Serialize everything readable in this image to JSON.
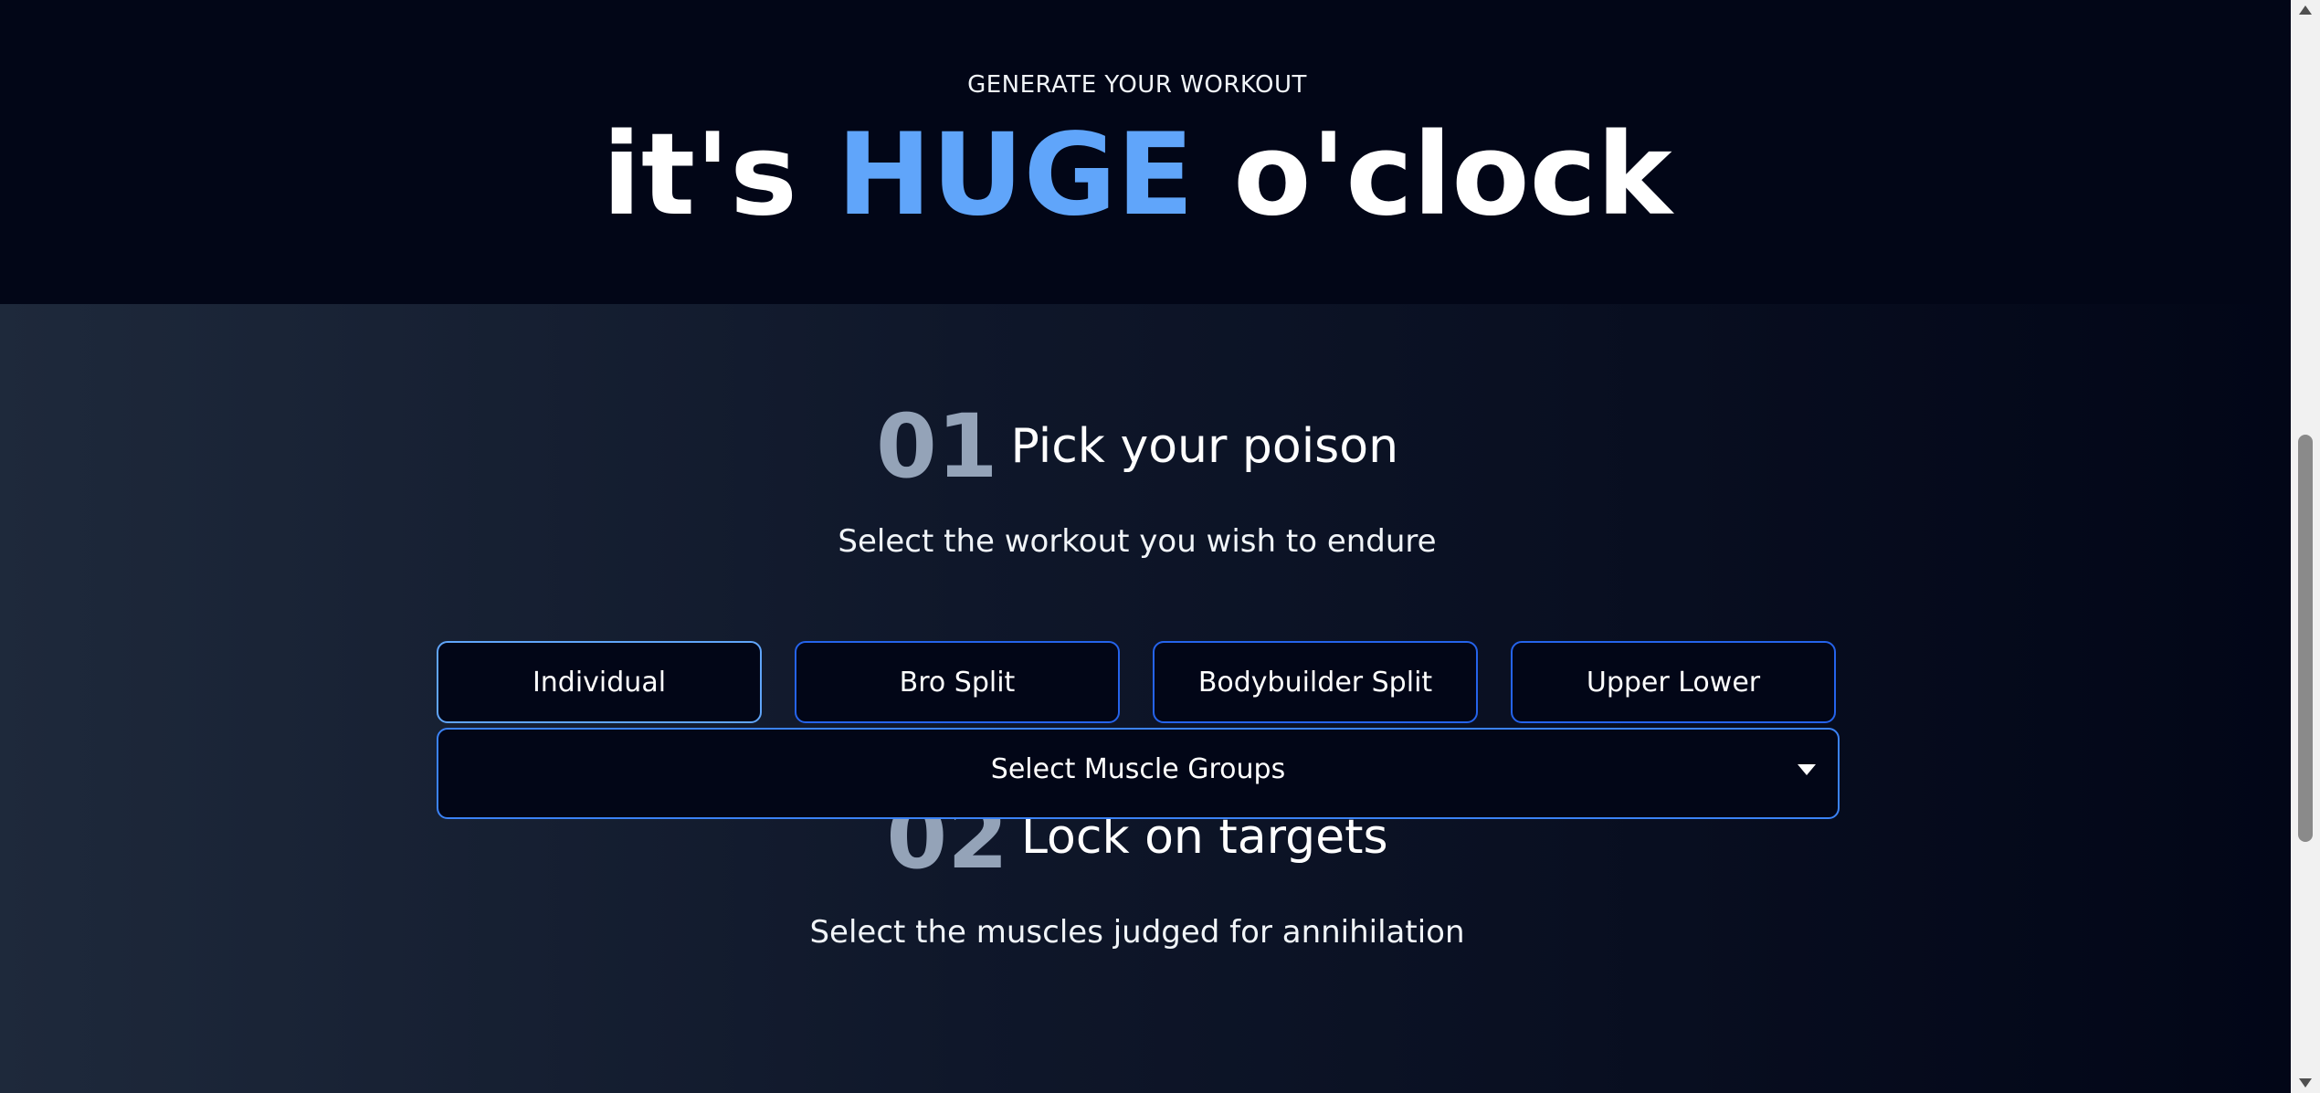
{
  "hero": {
    "eyebrow": "GENERATE YOUR WORKOUT",
    "title_before": "it's ",
    "title_accent": "HUGE",
    "title_after": " o'clock",
    "accent_color": "#60a5fa"
  },
  "step1": {
    "number": "01",
    "title": "Pick your poison",
    "subtitle": "Select the workout you wish to endure",
    "options": [
      {
        "label": "Individual"
      },
      {
        "label": "Bro Split"
      },
      {
        "label": "Bodybuilder Split"
      },
      {
        "label": "Upper Lower"
      }
    ]
  },
  "step2": {
    "number": "02",
    "title": "Lock on targets",
    "subtitle": "Select the muscles judged for annihilation",
    "select_label": "Select Muscle Groups"
  },
  "icons": {
    "select_caret": "caret-down-icon"
  }
}
